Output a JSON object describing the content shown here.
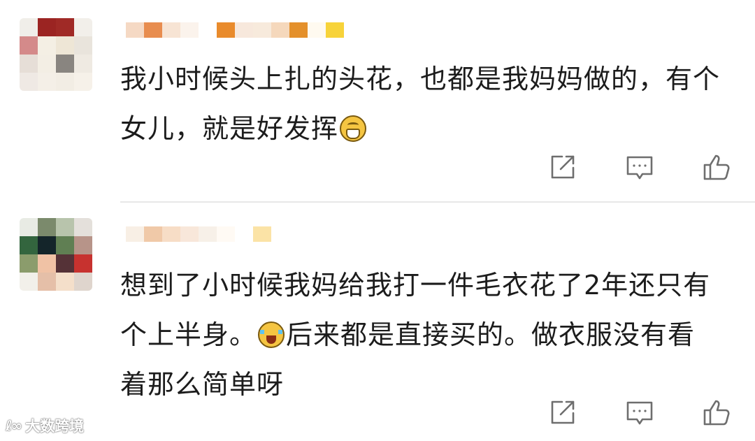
{
  "comments": [
    {
      "text_part1": "我小时候头上扎的头花，也都是我妈妈做的，有个女儿，就是好发挥",
      "emoji": "grin-emoji",
      "text_part2": "",
      "avatar_colors": [
        "#f0eee9",
        "#9b2422",
        "#a02a26",
        "#f2efea",
        "#d48a8a",
        "#f4efe4",
        "#eee6d6",
        "#e9e4dc",
        "#e6ded7",
        "#f3eee4",
        "#898580",
        "#efeae2",
        "#efe9e4",
        "#f4efe7",
        "#f2ede4",
        "#f6f1e9"
      ],
      "username_colors": [
        "#f5d9c4",
        "#e88d4f",
        "#f7e4d4",
        "#fbf3ec",
        "#ffffff",
        "#e98b2c",
        "#f7e8dc",
        "#f7eadc",
        "#f5d8bc",
        "#e4902b",
        "#fffaf0",
        "#f7d33a"
      ]
    },
    {
      "text_part1": "想到了小时候我妈给我打一件毛衣花了2年还只有个上半身。",
      "emoji": "cry-laugh-emoji",
      "text_part2": "后来都是直接买的。做衣服没有看着那么简单呀",
      "avatar_colors": [
        "#e8ebe4",
        "#7b8a6c",
        "#b8c4ac",
        "#e4e0db",
        "#33653e",
        "#14252a",
        "#607f53",
        "#b79489",
        "#8b9c6c",
        "#f0c2a5",
        "#553237",
        "#c7322f",
        "#f2f0ea",
        "#e5bfa8",
        "#f4dfca",
        "#dfd5cd"
      ],
      "username_colors": [
        "#f8efe5",
        "#f0c9a8",
        "#f7ddc6",
        "#f8e7da",
        "#f7f0e8",
        "#fffaf4",
        "#ffffff",
        "#fbe3a6"
      ]
    }
  ],
  "actions": {
    "share_icon": "share-icon",
    "reply_icon": "comment-icon",
    "like_icon": "thumbs-up-icon"
  },
  "watermark": {
    "logo": "ℓ∞",
    "text": "大数跨境"
  }
}
